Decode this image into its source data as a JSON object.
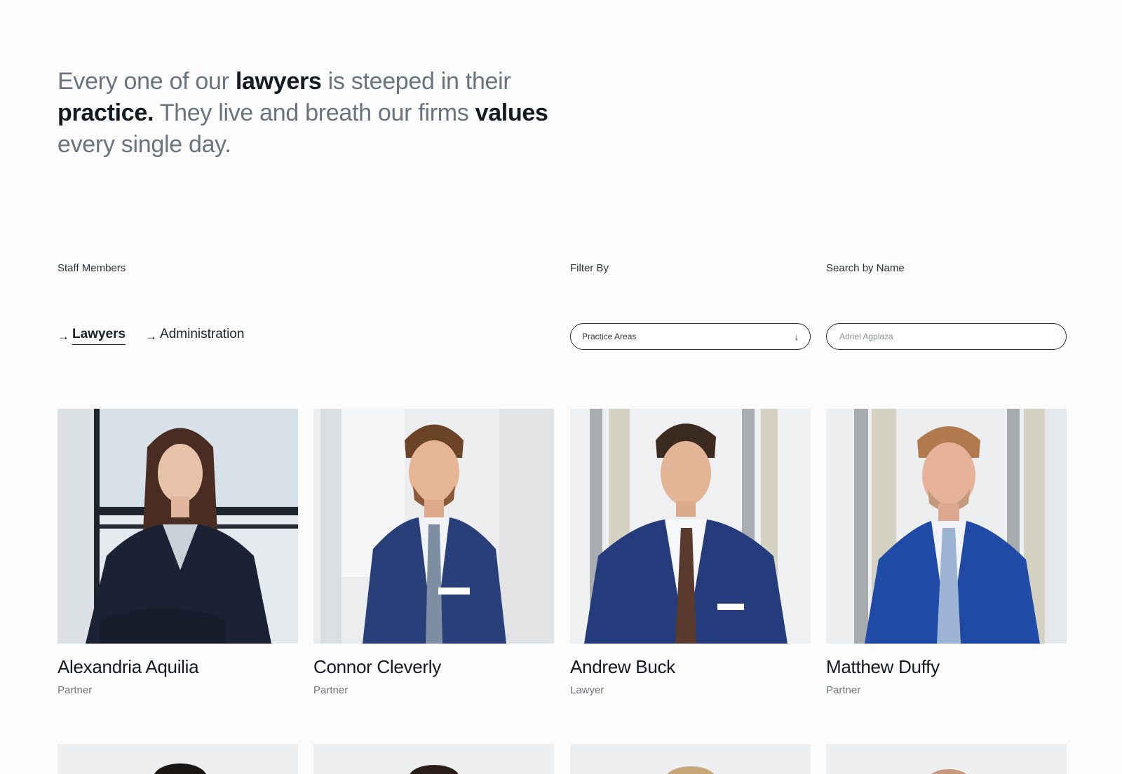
{
  "hero": {
    "part1": "Every one of our ",
    "bold1": "lawyers",
    "part2": " is steeped in their ",
    "bold2": "practice.",
    "part3": " They live and breath our firms ",
    "bold3": "values",
    "part4": " every single day."
  },
  "labels": {
    "staff_members": "Staff Members",
    "filter_by": "Filter By",
    "search_by_name": "Search by Name"
  },
  "tabs": [
    {
      "label": "Lawyers",
      "active": true
    },
    {
      "label": "Administration",
      "active": false
    }
  ],
  "filter": {
    "selected": "Practice Areas",
    "icon": "arrow-down-icon"
  },
  "search": {
    "placeholder": "Adriel Agplaza"
  },
  "staff": [
    {
      "name": "Alexandria Aquilia",
      "role": "Partner"
    },
    {
      "name": "Connor Cleverly",
      "role": "Partner"
    },
    {
      "name": "Andrew Buck",
      "role": "Lawyer"
    },
    {
      "name": "Matthew Duffy",
      "role": "Partner"
    }
  ],
  "colors": {
    "background": "#fcfcfd",
    "text_dark": "#141a22",
    "text_muted": "#6a737d",
    "suit_navy": "#1f3a78",
    "suit_dark": "#1c2436"
  }
}
